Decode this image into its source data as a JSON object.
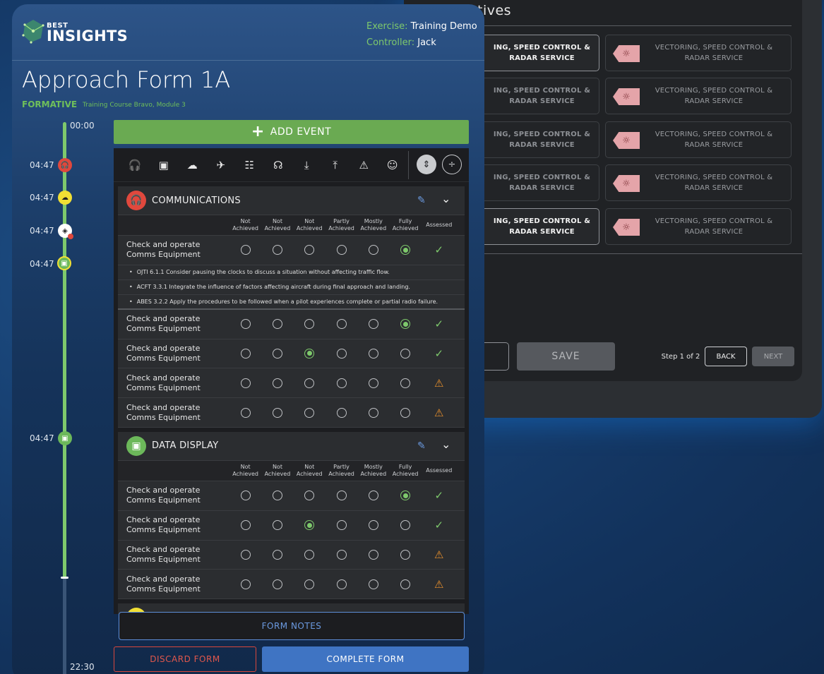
{
  "background_panel": {
    "title": "tives",
    "cards_left": [
      "ING, SPEED CONTROL & RADAR SERVICE",
      "ING, SPEED CONTROL & RADAR SERVICE",
      "ING, SPEED CONTROL & RADAR SERVICE",
      "ING, SPEED CONTROL & RADAR SERVICE",
      "ING, SPEED CONTROL & RADAR SERVICE"
    ],
    "cards_right": [
      "VECTORING, SPEED CONTROL & RADAR SERVICE",
      "VECTORING, SPEED CONTROL & RADAR SERVICE",
      "VECTORING, SPEED CONTROL & RADAR SERVICE",
      "VECTORING, SPEED CONTROL & RADAR SERVICE",
      "VECTORING, SPEED CONTROL & RADAR SERVICE"
    ],
    "save_label": "SAVE",
    "step_label": "Step 1 of 2",
    "back_label": "BACK",
    "next_label": "NEXT"
  },
  "header": {
    "logo_best": "BEST",
    "logo_insights": "INSIGHTS",
    "exercise_key": "Exercise:",
    "exercise_value": "Training Demo",
    "controller_key": "Controller:",
    "controller_value": "Jack"
  },
  "form": {
    "title": "Approach Form 1A",
    "type": "FORMATIVE",
    "course": "Training Course Bravo, Module 3"
  },
  "timeline": {
    "start": "00:00",
    "end": "22:30",
    "events": [
      "04:47",
      "04:47",
      "04:47",
      "04:47",
      "04:47"
    ]
  },
  "add_event_label": "ADD EVENT",
  "toolbar_icons": [
    "headphones-icon",
    "monitor-icon",
    "weather-icon",
    "plane-icon",
    "group-icon",
    "speaker-icon",
    "landing-icon",
    "takeoff-icon",
    "warning-icon",
    "people-icon"
  ],
  "columns": [
    "Not Achieved",
    "Not Achieved",
    "Not Achieved",
    "Partly Achieved",
    "Mostly Achieved",
    "Fully Achieved",
    "Assessed"
  ],
  "sections": [
    {
      "title": "COMMUNICATIONS",
      "color": "#e0483d",
      "rows": [
        {
          "label": "Check and operate Comms Equipment",
          "selected": 5,
          "status": "check"
        },
        {
          "label": "Check and operate Comms Equipment",
          "selected": 5,
          "status": "check"
        },
        {
          "label": "Check and operate Comms Equipment",
          "selected": 2,
          "status": "check"
        },
        {
          "label": "Check and operate Comms Equipment",
          "selected": -1,
          "status": "warn"
        },
        {
          "label": "Check and operate Comms Equipment",
          "selected": -1,
          "status": "warn"
        }
      ],
      "notes": [
        "OJTI 6.1.1 Consider pausing the clocks to discuss a situation without affecting traffic flow.",
        "ACFT 3.3.1 Integrate the influence of factors affecting aircraft during final approach and landing.",
        "ABES 3.2.2 Apply the procedures to be followed when a pilot experiences complete or partial radio failure."
      ]
    },
    {
      "title": "DATA DISPLAY",
      "color": "#6cb85a",
      "rows": [
        {
          "label": "Check and operate Comms Equipment",
          "selected": 5,
          "status": "check"
        },
        {
          "label": "Check and operate Comms Equipment",
          "selected": 2,
          "status": "check"
        },
        {
          "label": "Check and operate Comms Equipment",
          "selected": -1,
          "status": "warn"
        },
        {
          "label": "Check and operate Comms Equipment",
          "selected": -1,
          "status": "warn"
        }
      ]
    }
  ],
  "footer": {
    "form_notes": "FORM NOTES",
    "discard": "DISCARD FORM",
    "complete": "COMPLETE FORM"
  }
}
